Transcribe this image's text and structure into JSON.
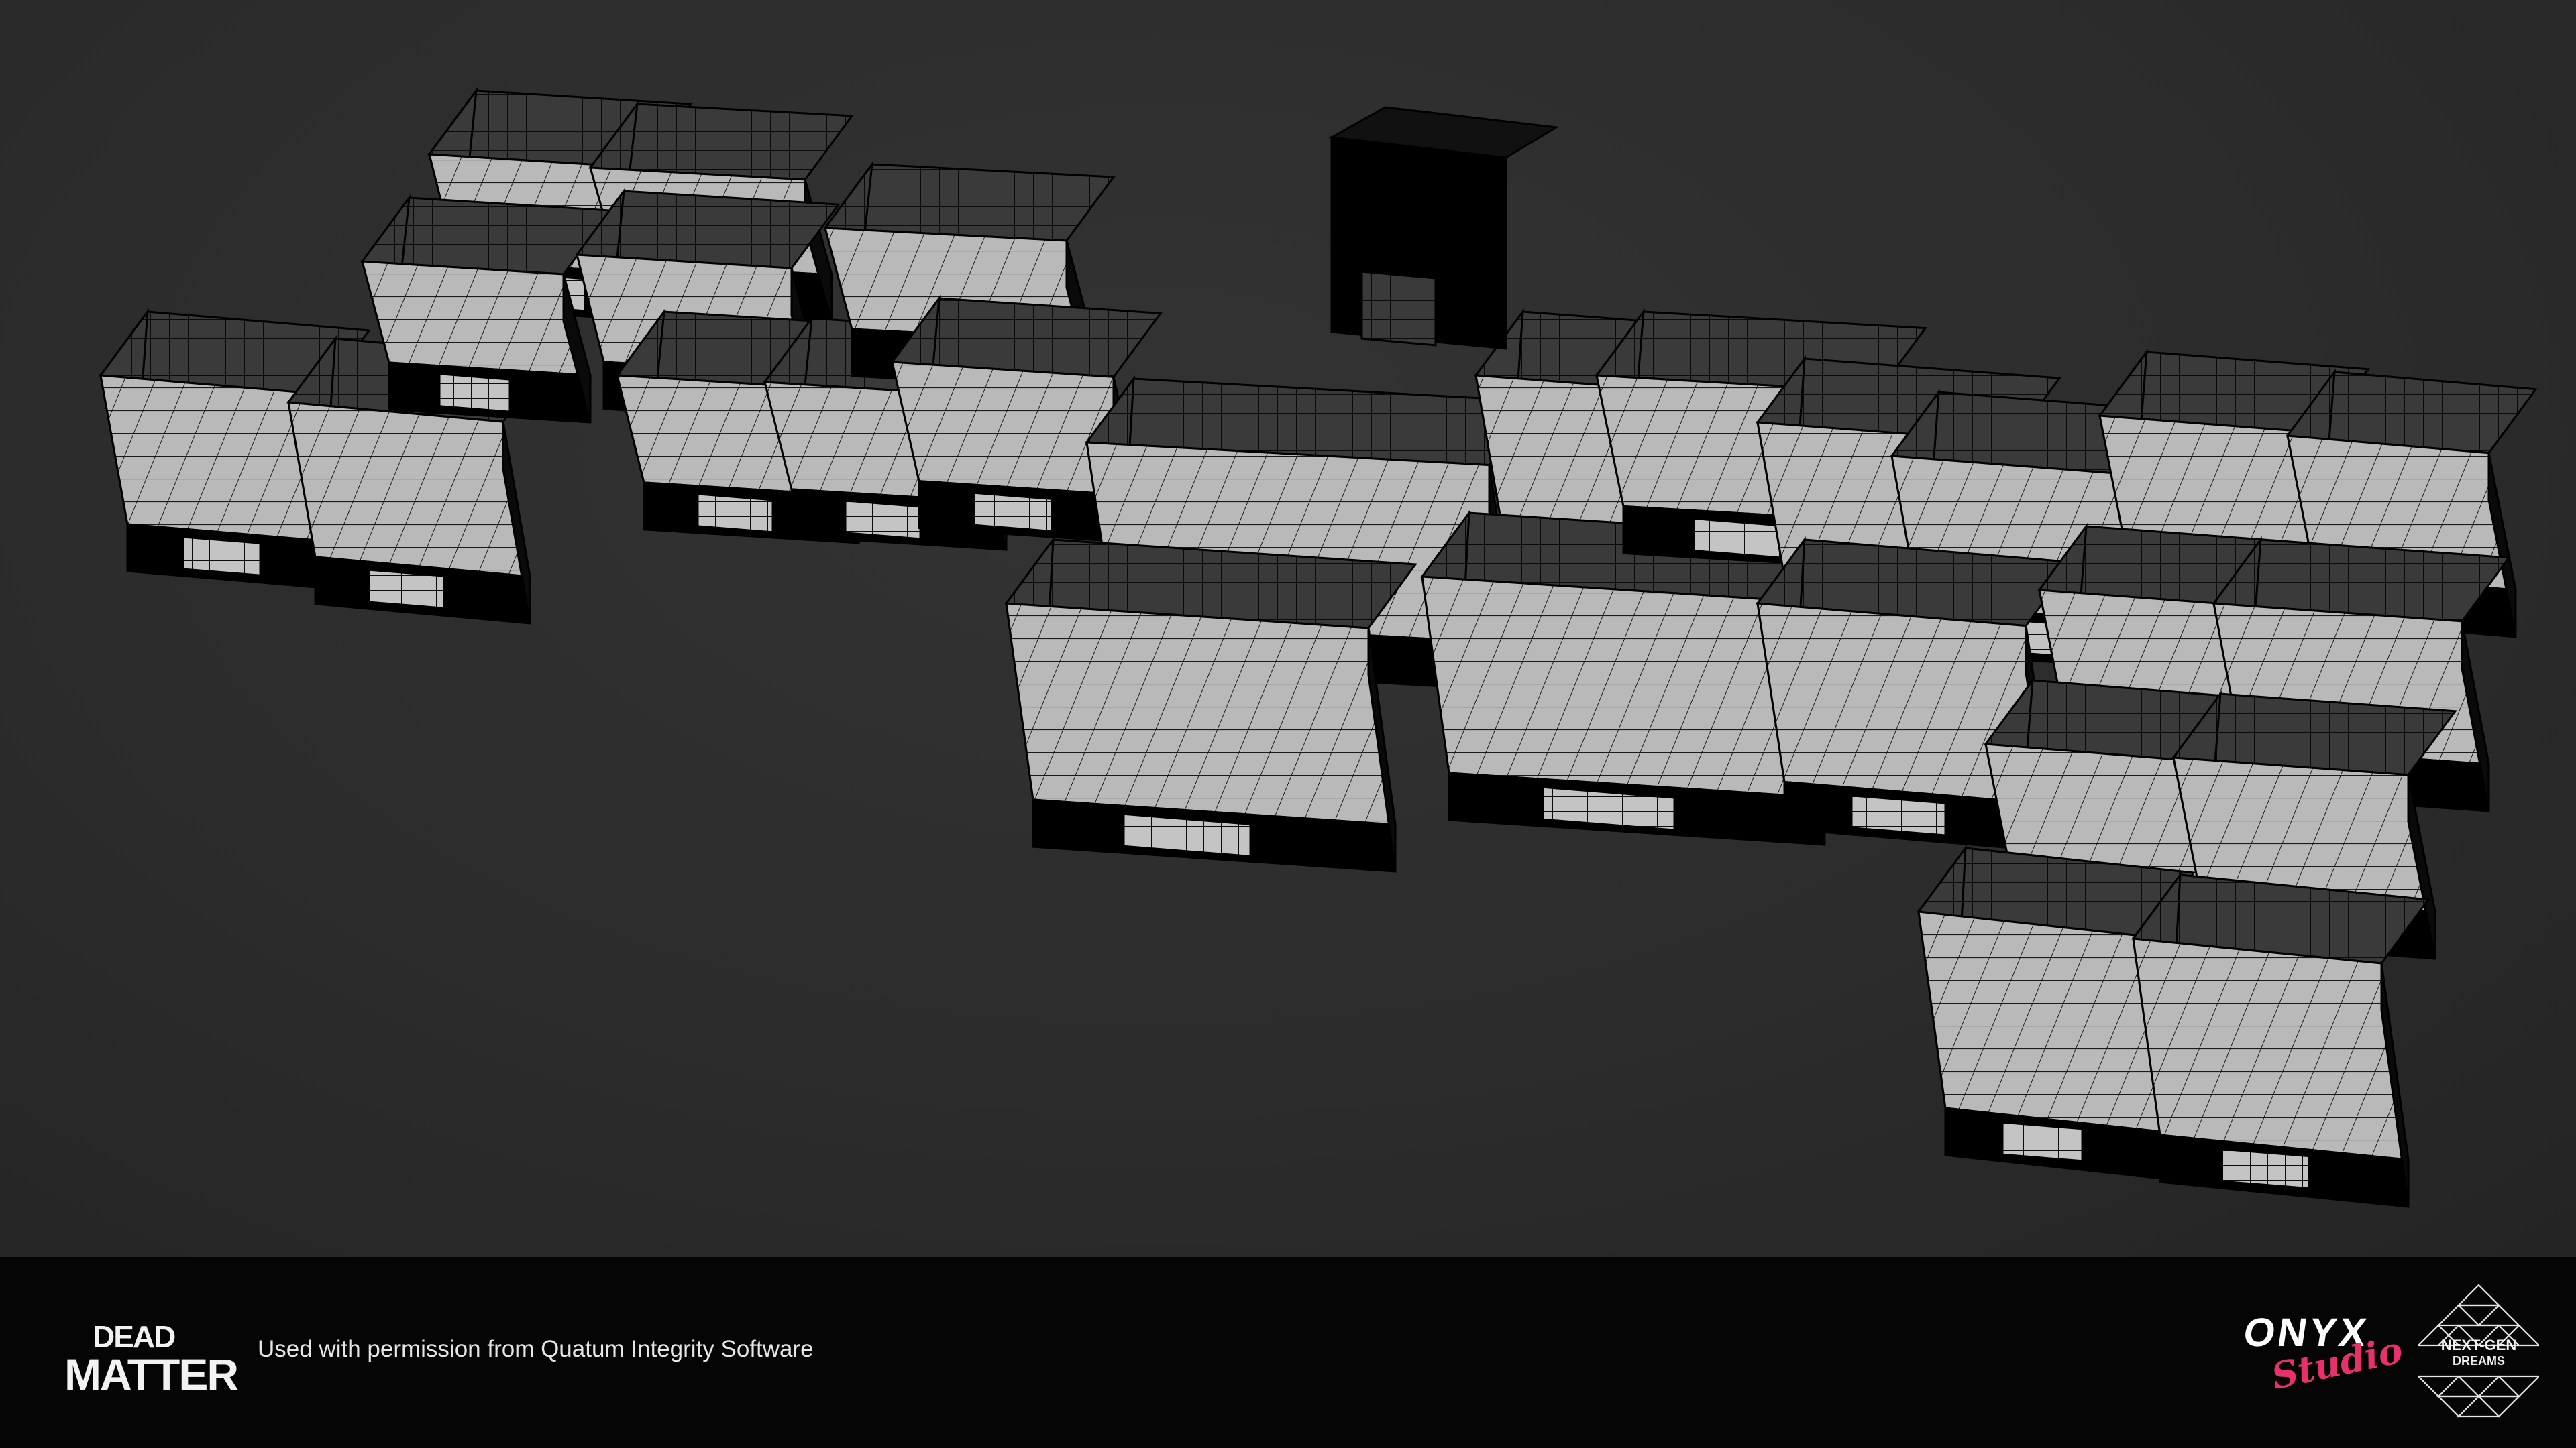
{
  "footer": {
    "game_logo_line1": "DEAD",
    "game_logo_line2": "MATTER",
    "credit_text": "Used with permission from Quatum Integrity Software",
    "studio_logo_word": "ONYX",
    "studio_logo_script": "Studio",
    "partner_logo_line1": "NEXT-GEN",
    "partner_logo_line2": "DREAMS"
  },
  "colors": {
    "background": "#2b2b2b",
    "footer": "#050505",
    "wall_fill": "#383838",
    "wall_dark": "#000000",
    "floor_fill": "#b8b8b8",
    "grid_line": "#0a0a0a",
    "accent_pink": "#e8306b"
  }
}
